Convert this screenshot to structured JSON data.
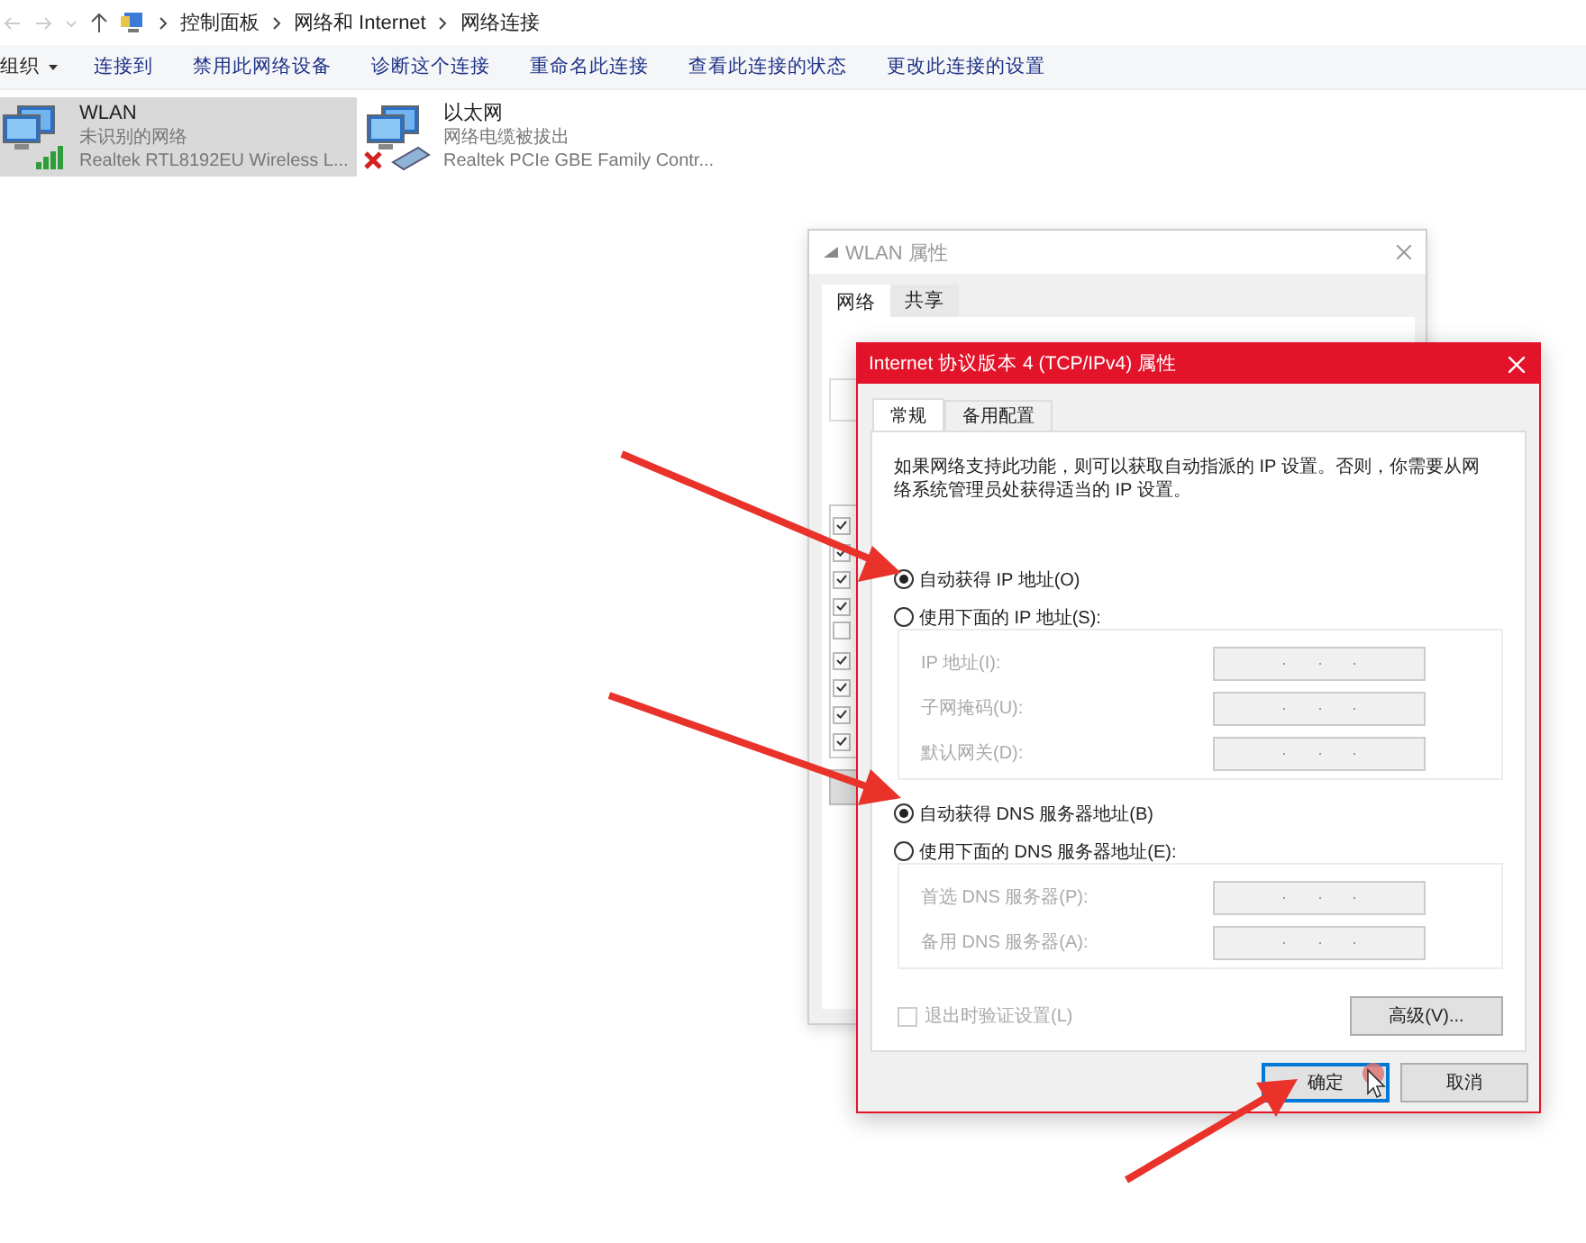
{
  "address_bar": {
    "crumbs": [
      "控制面板",
      "网络和 Internet",
      "网络连接"
    ]
  },
  "toolbar": [
    {
      "label": "组织",
      "kind": "menu"
    },
    {
      "label": "连接到",
      "kind": "action"
    },
    {
      "label": "禁用此网络设备",
      "kind": "action"
    },
    {
      "label": "诊断这个连接",
      "kind": "action"
    },
    {
      "label": "重命名此连接",
      "kind": "action"
    },
    {
      "label": "查看此连接的状态",
      "kind": "action"
    },
    {
      "label": "更改此连接的设置",
      "kind": "action"
    }
  ],
  "connections": [
    {
      "name": "WLAN",
      "status": "未识别的网络",
      "adapter": "Realtek RTL8192EU Wireless L...",
      "kind": "wireless",
      "selected": true
    },
    {
      "name": "以太网",
      "status": "网络电缆被拔出",
      "adapter": "Realtek PCIe GBE Family Contr...",
      "kind": "ethernet",
      "selected": false
    }
  ],
  "wlan_window": {
    "title": "WLAN 属性",
    "tabs": [
      {
        "label": "网络",
        "selected": true
      },
      {
        "label": "共享",
        "selected": false
      }
    ],
    "items": [
      {
        "checked": true
      },
      {
        "checked": true
      },
      {
        "checked": true
      },
      {
        "checked": true
      },
      {
        "checked": false
      },
      {
        "checked": true
      },
      {
        "checked": true
      },
      {
        "checked": true
      },
      {
        "checked": true
      }
    ]
  },
  "ipv4_dialog": {
    "title": "Internet 协议版本 4 (TCP/IPv4) 属性",
    "tabs": [
      {
        "label": "常规",
        "selected": true
      },
      {
        "label": "备用配置",
        "selected": false
      }
    ],
    "description": "如果网络支持此功能，则可以获取自动指派的 IP 设置。否则，你需要从网络系统管理员处获得适当的 IP 设置。",
    "ip_options": [
      {
        "label": "自动获得 IP 地址(O)",
        "selected": true
      },
      {
        "label": "使用下面的 IP 地址(S):",
        "selected": false
      }
    ],
    "ip_fields": [
      {
        "label": "IP 地址(I):",
        "disabled": true
      },
      {
        "label": "子网掩码(U):",
        "disabled": true
      },
      {
        "label": "默认网关(D):",
        "disabled": true
      }
    ],
    "dns_options": [
      {
        "label": "自动获得 DNS 服务器地址(B)",
        "selected": true
      },
      {
        "label": "使用下面的 DNS 服务器地址(E):",
        "selected": false
      }
    ],
    "dns_fields": [
      {
        "label": "首选 DNS 服务器(P):",
        "disabled": true
      },
      {
        "label": "备用 DNS 服务器(A):",
        "disabled": true
      }
    ],
    "validate": {
      "label": "退出时验证设置(L)",
      "checked": false,
      "disabled": true
    },
    "advanced_button": "高级(V)...",
    "buttons": [
      {
        "label": "确定",
        "focused": true
      },
      {
        "label": "取消",
        "focused": false
      }
    ]
  }
}
